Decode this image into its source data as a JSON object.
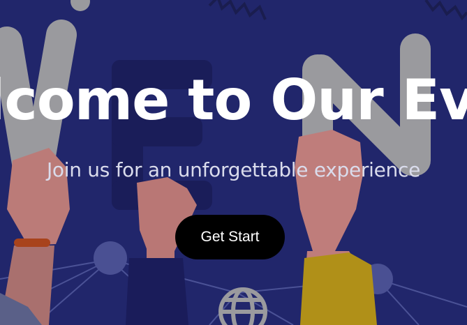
{
  "hero": {
    "title": "Welcome to Our Event",
    "subtitle": "Join us for an unforgettable experience",
    "cta_label": "Get Start"
  },
  "colors": {
    "background": "#21266b",
    "button": "#000000",
    "text": "#ffffff"
  },
  "icons": [
    "globe-icon"
  ]
}
